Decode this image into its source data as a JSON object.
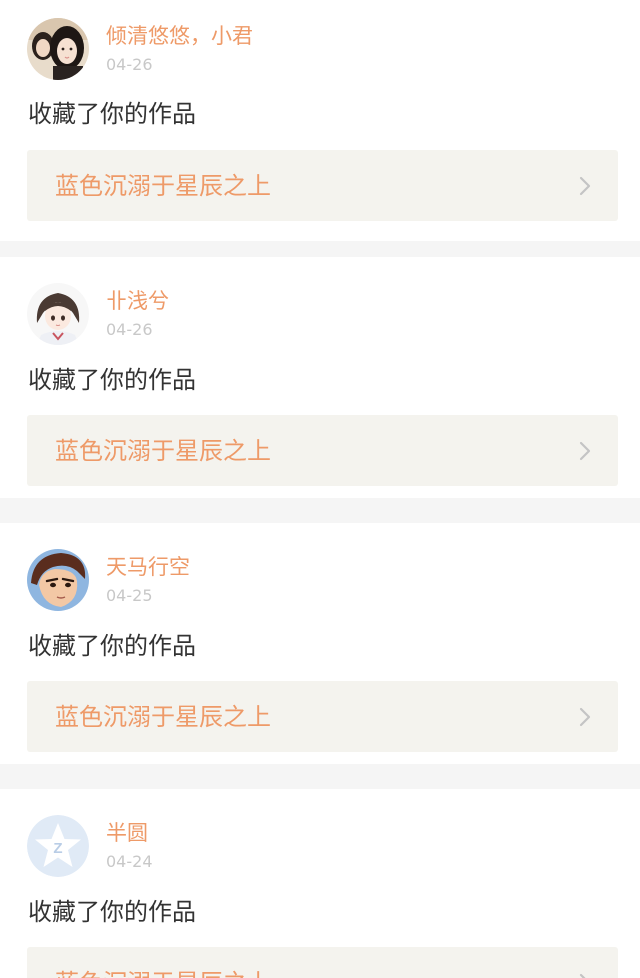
{
  "theme": {
    "accent_color": "#ef6b95",
    "name_color": "#ee9a68",
    "date_color": "#c8c8c8",
    "text_color": "#333333",
    "link_bg": "#f4f3ee"
  },
  "feed": [
    {
      "username": "倾清悠悠，小君",
      "date": "04-26",
      "action": "收藏了你的作品",
      "work_title": "蓝色沉溺于星辰之上",
      "avatar": "two-girls-photo-avatar",
      "link_icon": "chevron-right-icon"
    },
    {
      "username": "卝浅兮",
      "date": "04-26",
      "action": "收藏了你的作品",
      "work_title": "蓝色沉溺于星辰之上",
      "avatar": "anime-girl-avatar",
      "link_icon": "chevron-right-icon"
    },
    {
      "username": "天马行空",
      "date": "04-25",
      "action": "收藏了你的作品",
      "work_title": "蓝色沉溺于星辰之上",
      "avatar": "comic-character-avatar",
      "link_icon": "chevron-right-icon"
    },
    {
      "username": "半圆",
      "date": "04-24",
      "action": "收藏了你的作品",
      "work_title": "蓝色沉溺于星辰之上",
      "avatar": "default-star-avatar",
      "link_icon": "chevron-right-icon"
    }
  ]
}
